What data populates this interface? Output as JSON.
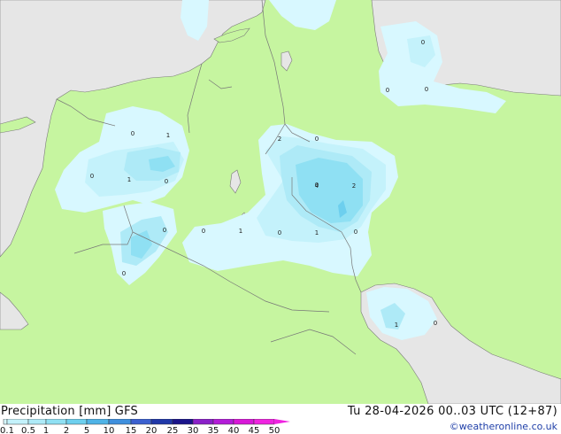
{
  "footer": {
    "title_left": "Precipitation [mm] GFS",
    "title_right": "Tu 28-04-2026 00..03 UTC (12+87)",
    "credit": "©weatheronline.co.uk"
  },
  "legend": {
    "ticks": [
      "0.1",
      "0.5",
      "1",
      "2",
      "5",
      "10",
      "15",
      "20",
      "25",
      "30",
      "35",
      "40",
      "45",
      "50"
    ],
    "colors": [
      "#d8f8ff",
      "#c4f2fb",
      "#aeeaf7",
      "#8fe0f3",
      "#6dcfee",
      "#4fb3e6",
      "#3f8fdd",
      "#3b60cf",
      "#2038a8",
      "#1a148a",
      "#8a20c8",
      "#b31cd8",
      "#d818d8",
      "#ef24e0"
    ]
  },
  "map": {
    "land_color": "#c6f5a0",
    "sea_color": "#e6e6e6",
    "labels": [
      "0",
      "0",
      "0",
      "0",
      "1",
      "0",
      "0",
      "1",
      "0",
      "2",
      "0",
      "4",
      "2",
      "0",
      "1",
      "0",
      "1",
      "0",
      "0",
      "0",
      "1",
      "0"
    ]
  }
}
